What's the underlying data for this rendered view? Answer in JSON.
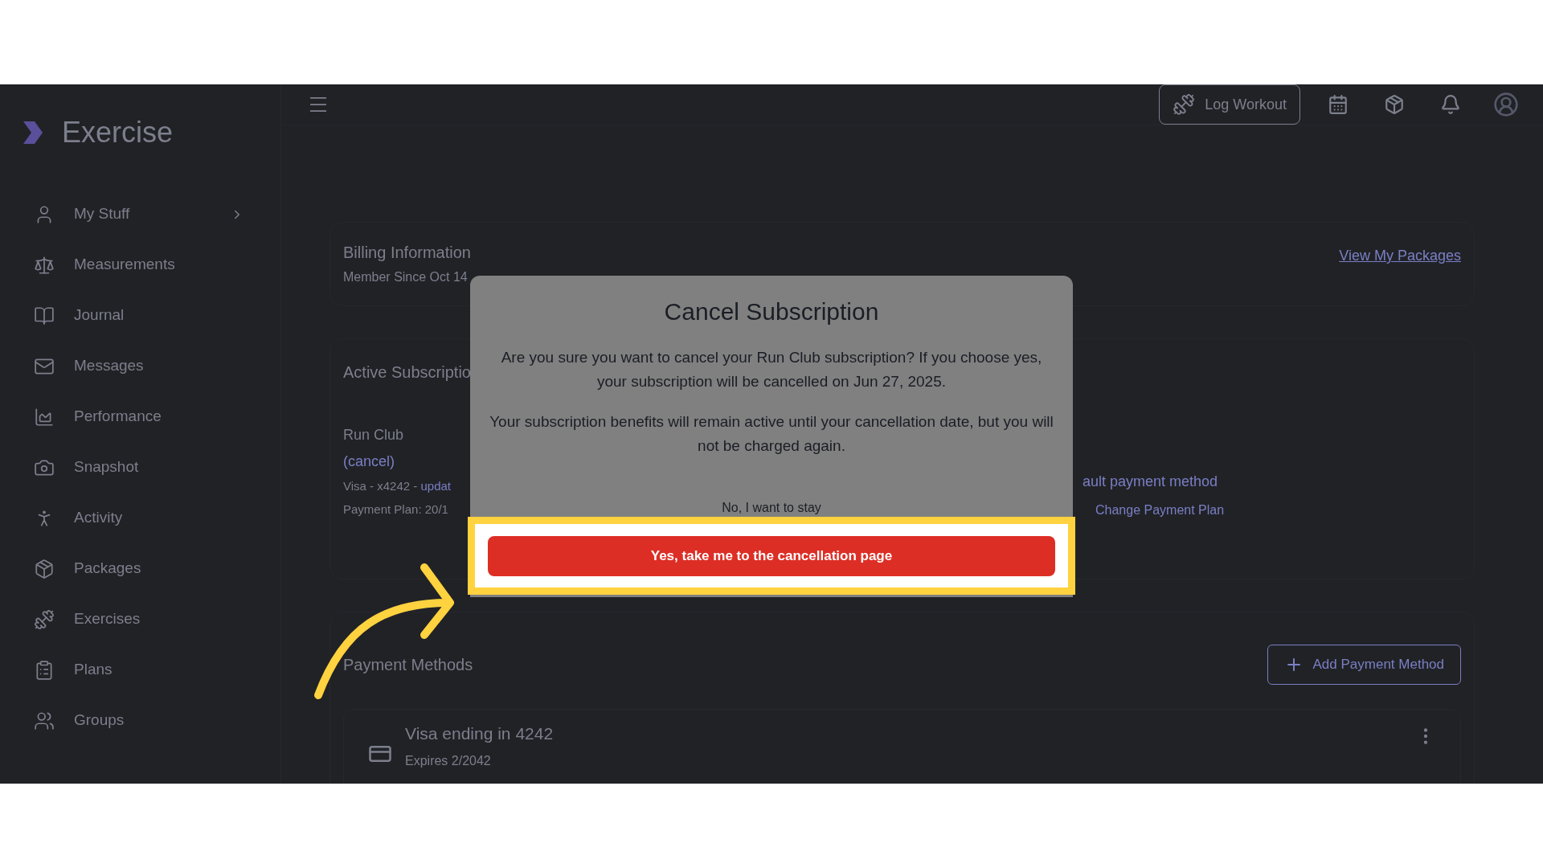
{
  "brand": {
    "name": "Exercise"
  },
  "sidebar": {
    "items": [
      {
        "label": "My Stuff",
        "expandable": true
      },
      {
        "label": "Measurements",
        "expandable": false
      },
      {
        "label": "Journal",
        "expandable": false
      },
      {
        "label": "Messages",
        "expandable": false
      },
      {
        "label": "Performance",
        "expandable": false
      },
      {
        "label": "Snapshot",
        "expandable": false
      },
      {
        "label": "Activity",
        "expandable": false
      },
      {
        "label": "Packages",
        "expandable": false
      },
      {
        "label": "Exercises",
        "expandable": false
      },
      {
        "label": "Plans",
        "expandable": false
      },
      {
        "label": "Groups",
        "expandable": false
      }
    ]
  },
  "topbar": {
    "log_workout": "Log Workout"
  },
  "billing": {
    "title": "Billing Information",
    "member_since": "Member Since Oct 14",
    "link": "View My Packages"
  },
  "subscriptions": {
    "title": "Active Subscriptio",
    "name": "Run Club",
    "cancel": "(cancel)",
    "card_prefix": "Visa - x4242 - ",
    "card_link": "updat",
    "plan": "Payment Plan: 20/1",
    "default_link": "ault payment method",
    "change_plan": "Change Payment Plan"
  },
  "payment_methods": {
    "title": "Payment Methods",
    "add": "Add Payment Method",
    "card_title": "Visa ending in 4242",
    "card_expiry": "Expires 2/2042"
  },
  "dialog": {
    "title": "Cancel Subscription",
    "paragraphs": [
      "Are you sure you want to cancel your Run Club subscription? If you choose yes, your subscription will be cancelled on Jun 27, 2025.",
      "Your subscription benefits will remain active until your cancellation date, but you will not be charged again."
    ],
    "stay": "No, I want to stay",
    "confirm": "Yes, take me to the cancellation page"
  }
}
